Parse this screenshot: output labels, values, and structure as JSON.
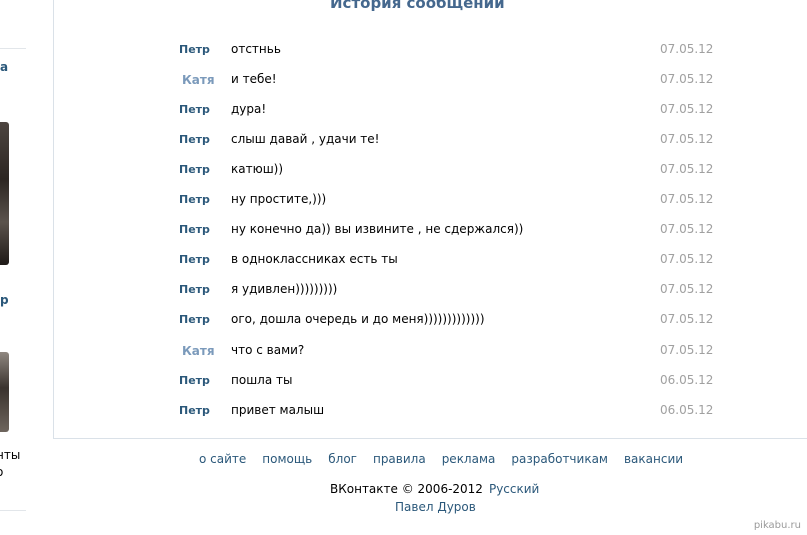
{
  "title": "История сообщений",
  "sidebar": {
    "item1": "а",
    "item2": "р",
    "item3_line1": "нты",
    "item3_line2": "о"
  },
  "messages": [
    {
      "author": "Петр",
      "text": "отстньь",
      "date": "07.05.12"
    },
    {
      "author": "Катя",
      "text": "и тебе!",
      "date": "07.05.12"
    },
    {
      "author": "Петр",
      "text": "дура!",
      "date": "07.05.12"
    },
    {
      "author": "Петр",
      "text": "слыш давай , удачи те!",
      "date": "07.05.12"
    },
    {
      "author": "Петр",
      "text": "катюш))",
      "date": "07.05.12"
    },
    {
      "author": "Петр",
      "text": "ну простите,)))",
      "date": "07.05.12"
    },
    {
      "author": "Петр",
      "text": "ну конечно да)) вы извините , не сдержался))",
      "date": "07.05.12"
    },
    {
      "author": "Петр",
      "text": "в одноклассниках есть ты",
      "date": "07.05.12"
    },
    {
      "author": "Петр",
      "text": "я удивлен)))))))))",
      "date": "07.05.12"
    },
    {
      "author": "Петр",
      "text": "ого, дошла очередь и до меня)))))))))))))",
      "date": "07.05.12"
    },
    {
      "author": "Катя",
      "text": "что с вами?",
      "date": "07.05.12"
    },
    {
      "author": "Петр",
      "text": "пошла ты",
      "date": "06.05.12"
    },
    {
      "author": "Петр",
      "text": "привет малыш",
      "date": "06.05.12"
    }
  ],
  "footer": {
    "links": [
      "о сайте",
      "помощь",
      "блог",
      "правила",
      "реклама",
      "разработчикам",
      "вакансии"
    ],
    "copyright": "ВКонтакте © 2006-2012",
    "language": "Русский",
    "author": "Павел Дуров"
  },
  "watermark": "pikabu.ru",
  "colors": {
    "link": "#2b587a",
    "title": "#45688e",
    "author_alt": "#7b9abb",
    "date": "#a0a0a0",
    "border": "#dae1e8"
  }
}
